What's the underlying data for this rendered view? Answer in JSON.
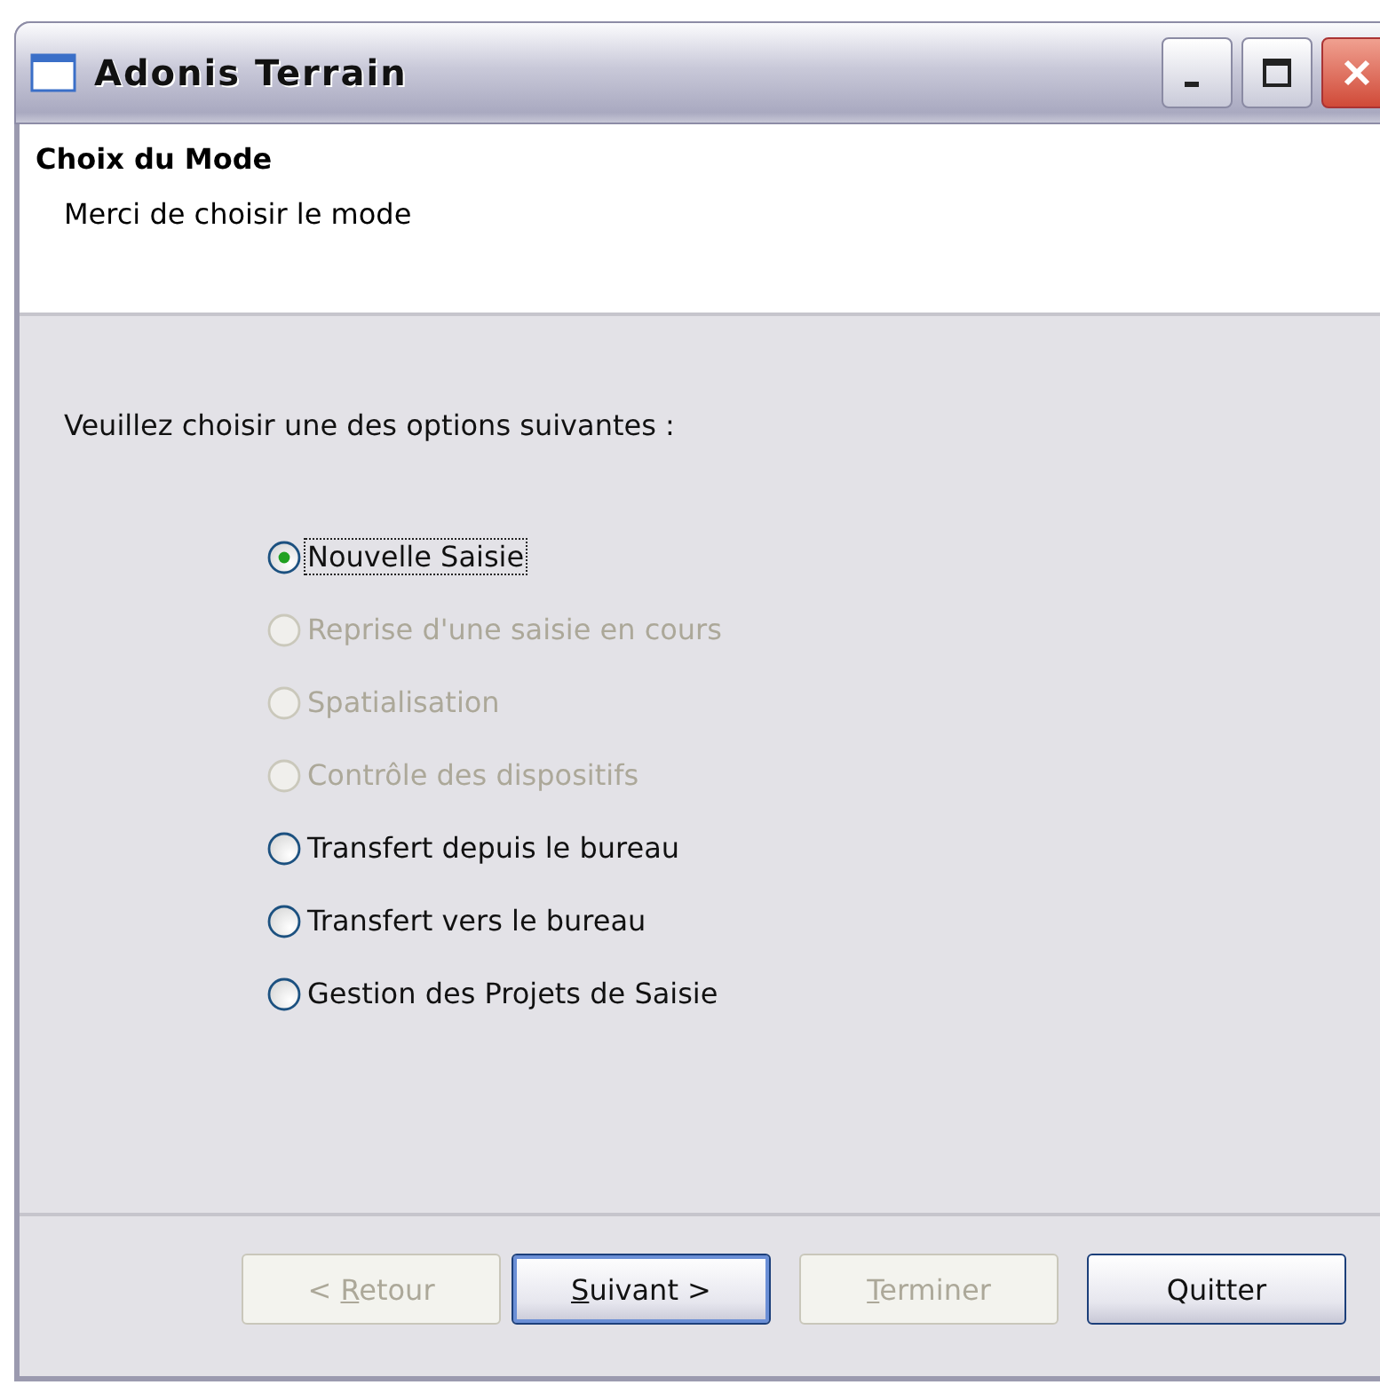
{
  "window": {
    "title": "Adonis Terrain"
  },
  "header": {
    "title": "Choix du Mode",
    "subtitle": "Merci de choisir le mode"
  },
  "prompt": "Veuillez choisir une des options suivantes :",
  "options": [
    {
      "label": "Nouvelle Saisie",
      "selected": true,
      "disabled": false,
      "focused": true
    },
    {
      "label": "Reprise d'une saisie en cours",
      "selected": false,
      "disabled": true,
      "focused": false
    },
    {
      "label": "Spatialisation",
      "selected": false,
      "disabled": true,
      "focused": false
    },
    {
      "label": "Contrôle des dispositifs",
      "selected": false,
      "disabled": true,
      "focused": false
    },
    {
      "label": "Transfert depuis le bureau",
      "selected": false,
      "disabled": false,
      "focused": false
    },
    {
      "label": "Transfert vers le bureau",
      "selected": false,
      "disabled": false,
      "focused": false
    },
    {
      "label": "Gestion des Projets de Saisie",
      "selected": false,
      "disabled": false,
      "focused": false
    }
  ],
  "buttons": [
    {
      "before": "< ",
      "key": "R",
      "after": "etour",
      "disabled": true,
      "default": false
    },
    {
      "key": "S",
      "after": "uivant >",
      "disabled": false,
      "default": true
    },
    {
      "key": "T",
      "after": "erminer",
      "disabled": true,
      "default": false
    },
    {
      "after": "Quitter",
      "disabled": false,
      "default": false
    }
  ]
}
